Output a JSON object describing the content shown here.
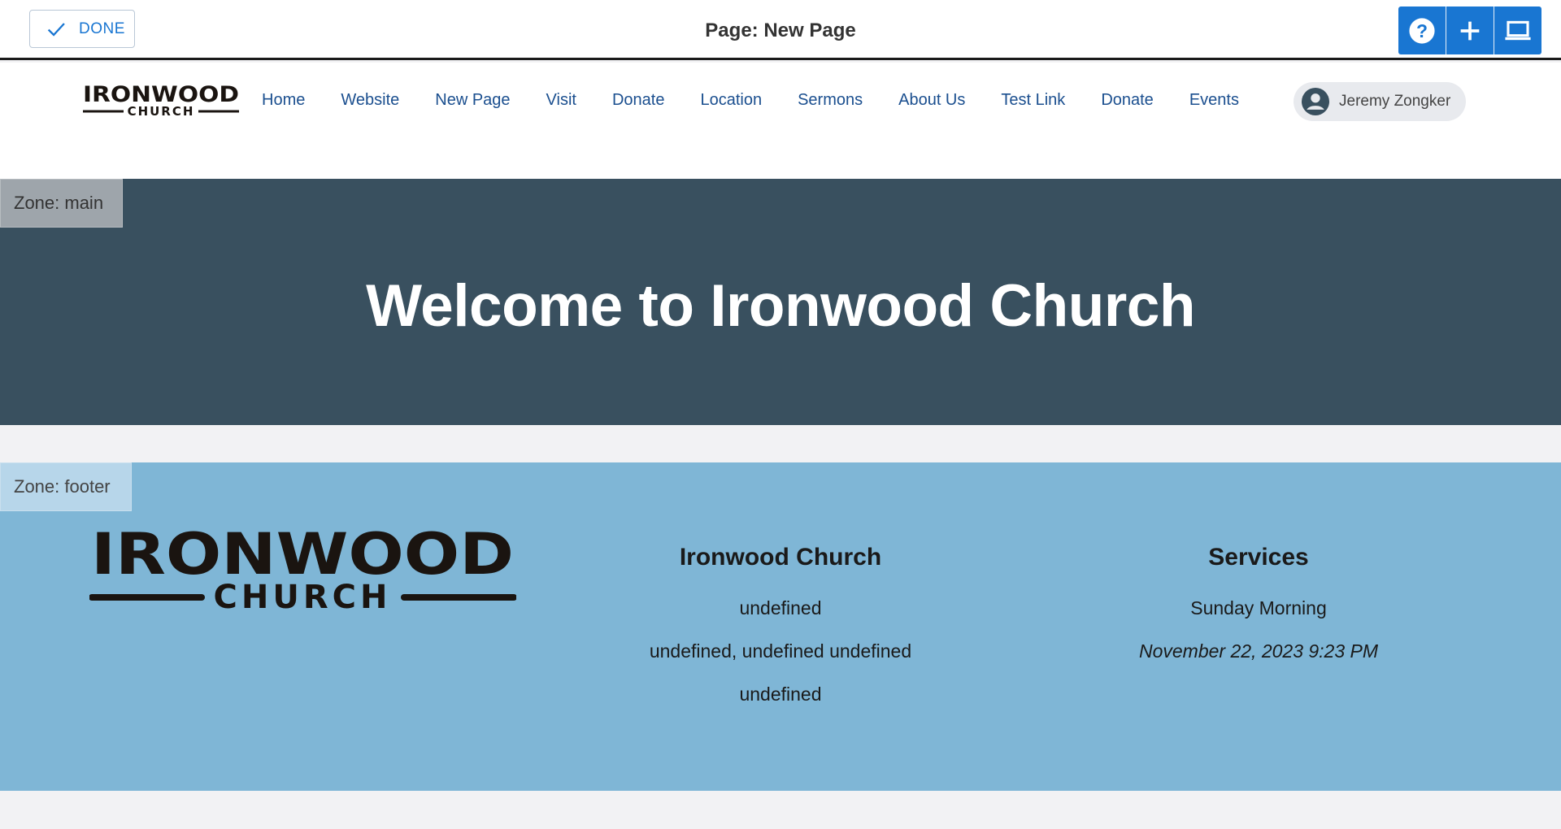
{
  "editor": {
    "done_label": "DONE",
    "page_title": "Page: New Page",
    "tools": [
      "help-icon",
      "plus-icon",
      "laptop-icon"
    ],
    "accent": "#1976d2"
  },
  "header": {
    "logo": {
      "line1": "IRONWOOD",
      "line2": "CHURCH"
    },
    "nav": [
      "Home",
      "Website",
      "New Page",
      "Visit",
      "Donate",
      "Location",
      "Sermons",
      "About Us",
      "Test Link",
      "Donate",
      "Events"
    ],
    "user": "Jeremy Zongker"
  },
  "zones": {
    "main": {
      "label": "Zone: main",
      "title": "Welcome to Ironwood Church",
      "bg": "#39505f"
    },
    "footer": {
      "label": "Zone: footer",
      "bg": "#7fb6d6",
      "church": {
        "heading": "Ironwood Church",
        "line1": "undefined",
        "line2": "undefined, undefined undefined",
        "line3": "undefined"
      },
      "services": {
        "heading": "Services",
        "name": "Sunday Morning",
        "datetime": "November 22, 2023 9:23 PM"
      }
    }
  }
}
